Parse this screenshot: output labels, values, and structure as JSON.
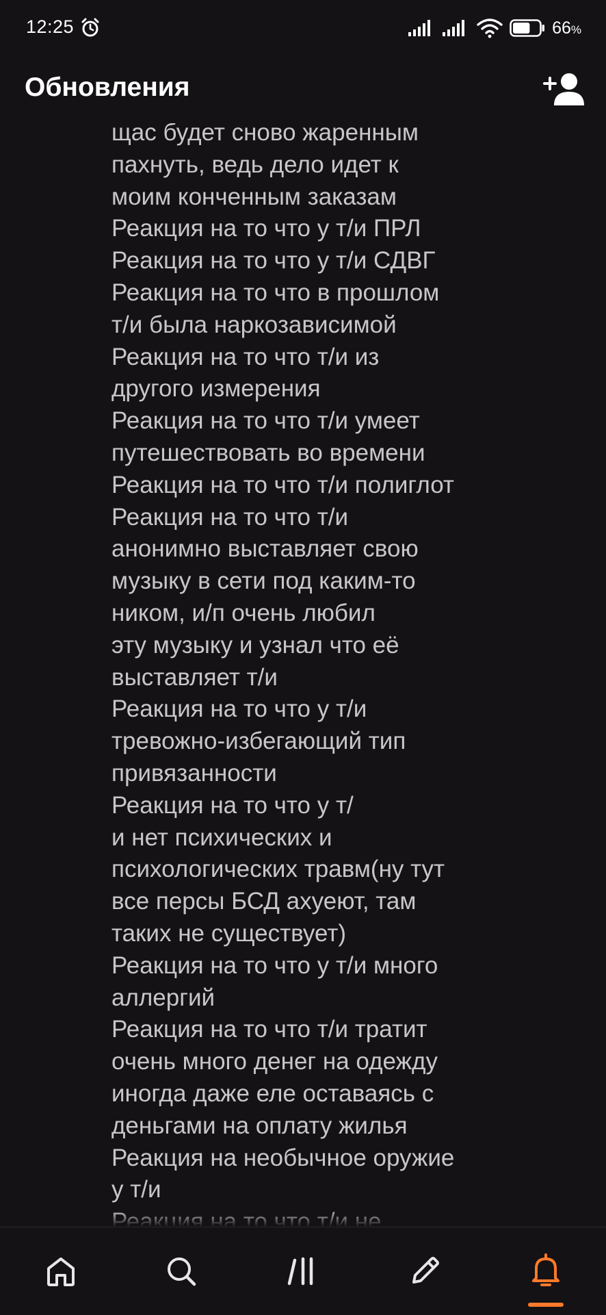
{
  "status_bar": {
    "time": "12:25",
    "battery_percent": "66",
    "battery_unit": "%",
    "battery_level": 0.66
  },
  "header": {
    "title": "Обновления"
  },
  "content": {
    "text": "щас будет сново жаренным\nпахнуть, ведь дело идет к\nмоим конченным заказам\nРеакция на то что у т/и ПРЛ\nРеакция на то что у т/и СДВГ\nРеакция на то что в прошлом\nт/и была наркозависимой\nРеакция на то что т/и из\nдругого измерения\nРеакция на то что т/и умеет\nпутешествовать во времени\nРеакция на то что т/и полиглот\nРеакция на то что т/и\nанонимно выставляет свою\nмузыку в сети под каким-то\nником, и/п очень любил\nэту музыку и узнал что её\nвыставляет т/и\nРеакция на то что у т/и\nтревожно-избегающий тип\nпривязанности\nРеакция на то что у т/\nи нет психических и\nпсихологических травм(ну тут\nвсе персы БСД ахуеют, там\nтаких не существует)\nРеакция на то что у т/и много\nаллергий\nРеакция на то что т/и тратит\nочень много денег на одежду\nиногда даже еле оставаясь с\nденьгами на оплату жилья\nРеакция на необычное оружие\nу т/и\nРеакция на то что т/и не"
  },
  "bottom_nav": {
    "items": [
      {
        "icon": "home-icon",
        "active": false
      },
      {
        "icon": "search-icon",
        "active": false
      },
      {
        "icon": "library-icon",
        "active": false
      },
      {
        "icon": "pencil-icon",
        "active": false
      },
      {
        "icon": "bell-icon",
        "active": true
      }
    ]
  },
  "colors": {
    "background": "#141215",
    "text_primary": "#ffffff",
    "text_body": "#c8c6c9",
    "icon_inactive": "#e8e6e9",
    "accent": "#ff7a2a"
  }
}
